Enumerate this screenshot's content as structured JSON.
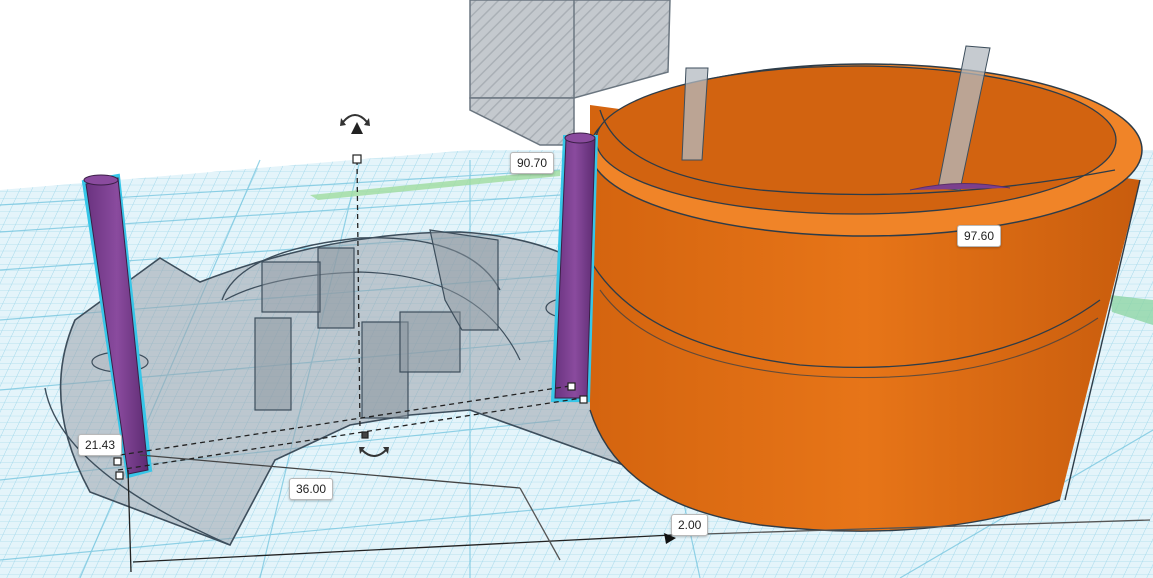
{
  "workplane": {
    "grid_color": "#7fcde6",
    "background": "#e4f4fa"
  },
  "colors": {
    "orange_shape": "#e06d17",
    "orange_rim": "#f08428",
    "purple_pillar": "#7b3f8e",
    "selection_outline": "#37c6e8",
    "hole_fill": "#9aa3ab"
  },
  "dimensions": {
    "width_top": "90.70",
    "orange_diameter": "97.60",
    "height_left": "21.43",
    "length_bottom": "36.00",
    "gap_right": "2.00"
  },
  "icons": {
    "rotate_top": "rotate-arrow-icon",
    "rotate_bottom": "rotate-arrow-icon",
    "lift": "lift-cone-icon"
  }
}
